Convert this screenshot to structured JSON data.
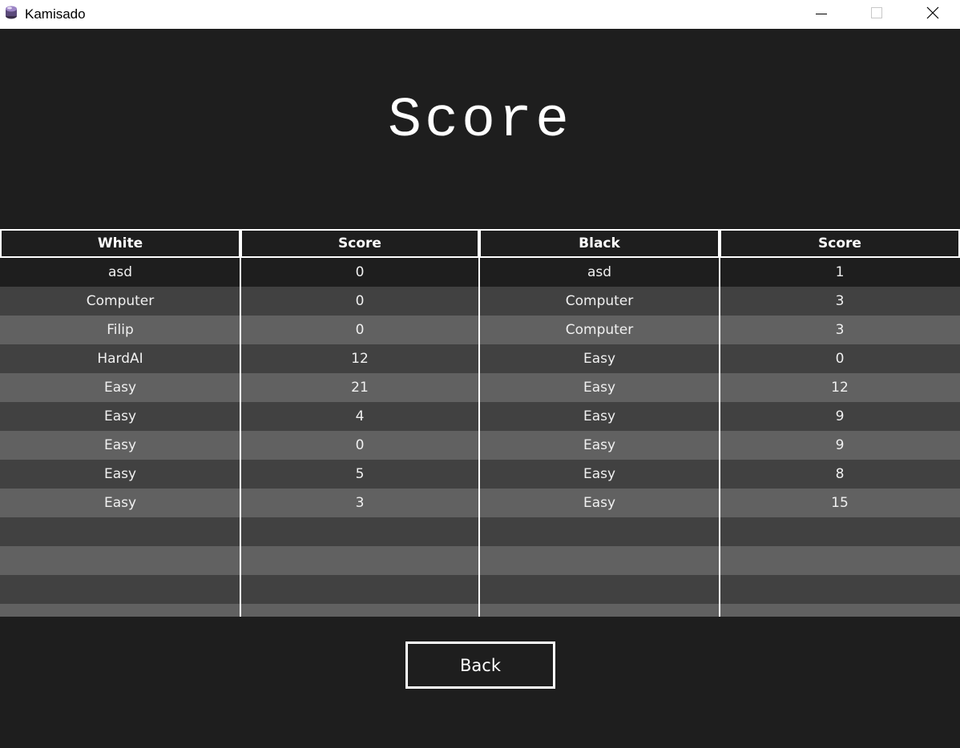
{
  "window": {
    "title": "Kamisado",
    "controls": [
      "minimize-icon",
      "maximize-icon",
      "close-icon"
    ]
  },
  "heading": "Score",
  "table": {
    "headers": [
      "White",
      "Score",
      "Black",
      "Score"
    ],
    "rows": [
      [
        "asd",
        "0",
        "asd",
        "1"
      ],
      [
        "Computer",
        "0",
        "Computer",
        "3"
      ],
      [
        "Filip",
        "0",
        "Computer",
        "3"
      ],
      [
        "HardAI",
        "12",
        "Easy",
        "0"
      ],
      [
        "Easy",
        "21",
        "Easy",
        "12"
      ],
      [
        "Easy",
        "4",
        "Easy",
        "9"
      ],
      [
        "Easy",
        "0",
        "Easy",
        "9"
      ],
      [
        "Easy",
        "5",
        "Easy",
        "8"
      ],
      [
        "Easy",
        "3",
        "Easy",
        "15"
      ],
      [
        "",
        "",
        "",
        ""
      ],
      [
        "",
        "",
        "",
        ""
      ],
      [
        "",
        "",
        "",
        ""
      ],
      [
        "",
        "",
        "",
        ""
      ]
    ]
  },
  "back_button": "Back",
  "colors": {
    "background": "#1e1e1e",
    "row_dark": "#414141",
    "row_light": "#616161",
    "text": "#ffffff"
  }
}
